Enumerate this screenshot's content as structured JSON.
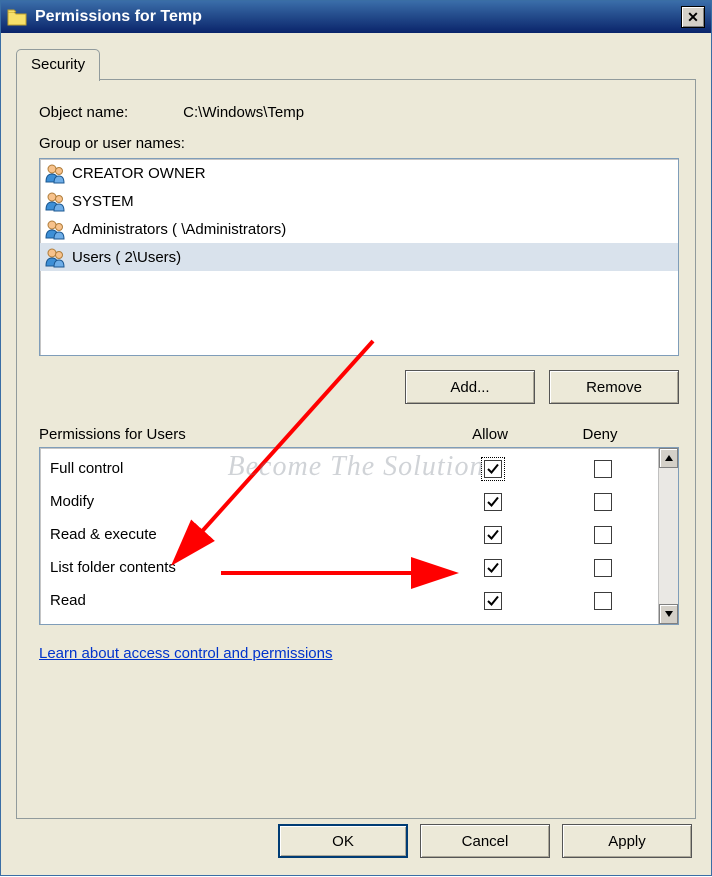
{
  "window": {
    "title": "Permissions for Temp"
  },
  "tab": {
    "label": "Security"
  },
  "object": {
    "label": "Object name:",
    "path": "C:\\Windows\\Temp"
  },
  "group_label": "Group or user names:",
  "principals": [
    {
      "name": "CREATOR OWNER",
      "selected": false
    },
    {
      "name": "SYSTEM",
      "selected": false
    },
    {
      "name": "Administrators (                          \\Administrators)",
      "selected": false
    },
    {
      "name": "Users (                         2\\Users)",
      "selected": true
    }
  ],
  "buttons": {
    "add": "Add...",
    "remove": "Remove",
    "ok": "OK",
    "cancel": "Cancel",
    "apply": "Apply"
  },
  "perm_header": {
    "for_label": "Permissions for Users",
    "allow": "Allow",
    "deny": "Deny"
  },
  "permissions": [
    {
      "name": "Full control",
      "allow": true,
      "deny": false,
      "focus": true
    },
    {
      "name": "Modify",
      "allow": true,
      "deny": false,
      "focus": false
    },
    {
      "name": "Read & execute",
      "allow": true,
      "deny": false,
      "focus": false
    },
    {
      "name": "List folder contents",
      "allow": true,
      "deny": false,
      "focus": false
    },
    {
      "name": "Read",
      "allow": true,
      "deny": false,
      "focus": false
    }
  ],
  "link": {
    "label": "Learn about access control and permissions"
  },
  "watermark": "Become The Solution"
}
